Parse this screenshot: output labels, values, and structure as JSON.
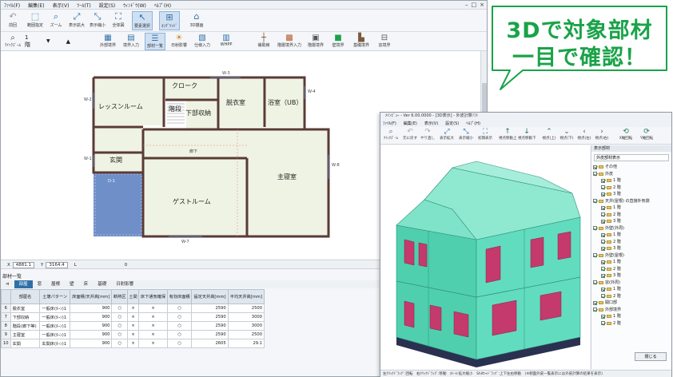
{
  "main_window": {
    "menu": [
      "ﾌｧｲﾙ(F)",
      "編集(E)",
      "表示(V)",
      "ﾂｰﾙ(T)",
      "設定(S)",
      "ｳｨﾝﾄﾞｳ(W)",
      "ﾍﾙﾌﾟ(H)"
    ],
    "toolbar1": [
      {
        "label": "前回",
        "icon": "undo-icon"
      },
      {
        "label": "範囲指定",
        "icon": "range-icon"
      },
      {
        "label": "ズーム",
        "icon": "zoom-icon"
      },
      {
        "label": "表示拡大",
        "icon": "zoom-in-icon"
      },
      {
        "label": "表示縮小",
        "icon": "zoom-out-icon"
      },
      {
        "label": "全体図",
        "icon": "fit-icon"
      },
      {
        "label": "要素選択",
        "icon": "cursor-icon"
      },
      {
        "label": "ｵﾝｸﾞﾘｯﾄﾞ",
        "icon": "grid-icon"
      },
      {
        "label": "3D描画",
        "icon": "3d-icon"
      }
    ],
    "toolbar2": {
      "left_label": "ｸｲｯｸｽﾞｰﾑ",
      "floor": "1 階",
      "buttons": [
        {
          "label": "外部境界",
          "icon": "boundary-icon"
        },
        {
          "label": "境界入力",
          "icon": "input-icon"
        },
        {
          "label": "部材一覧",
          "icon": "list-icon"
        },
        {
          "label": "日射影響",
          "icon": "sun-icon"
        },
        {
          "label": "仕様入力",
          "icon": "spec-icon"
        },
        {
          "label": "WHPP",
          "icon": "whpp-icon"
        },
        {
          "label": "補助線",
          "icon": "guide-icon"
        },
        {
          "label": "階層境界入力",
          "icon": "layer-icon"
        },
        {
          "label": "階層境界",
          "icon": "layer2-icon"
        },
        {
          "label": "壁境界",
          "icon": "wall-icon"
        },
        {
          "label": "基礎境界",
          "icon": "foundation-icon"
        },
        {
          "label": "窓境界",
          "icon": "window-icon"
        }
      ]
    },
    "rooms": [
      "レッスンルーム",
      "クローク",
      "階段",
      "下部収納",
      "脱衣室",
      "浴室（UB）",
      "玄関",
      "ゲストルーム",
      "主寝室",
      "D-1"
    ],
    "dims": [
      "W-3",
      "W-2",
      "W-4",
      "W-1",
      "W-7",
      "W-8",
      "D-1"
    ],
    "corridor_label": "廊下",
    "status": {
      "x_label": "X",
      "x_value": "4881.1",
      "y_label": "Y",
      "y_value": "3164.4",
      "l_label": "L",
      "l_value": "0"
    },
    "parts_list": {
      "title": "部材一覧",
      "tabs": [
        "部屋",
        "窓",
        "屋根",
        "壁",
        "床",
        "基礎",
        "日射影響"
      ],
      "headers": [
        "部屋名",
        "土壌パターン",
        "床面積/天井高[mm]",
        "断熱区",
        "土間",
        "床下通気確保",
        "有効床面積",
        "設定天井高[mm]",
        "平均天井高[mm]"
      ],
      "rows": [
        [
          "6",
          "脱衣室",
          "一般床(ﾀｰﾝ)1",
          "900",
          "○",
          "×",
          "×",
          "○",
          "2590",
          "2500"
        ],
        [
          "7",
          "下部収納",
          "一般床(ﾀｰﾝ)1",
          "900",
          "○",
          "×",
          "×",
          "○",
          "2590",
          "3000"
        ],
        [
          "8",
          "階段(廊下等)",
          "一般床(ﾀｰﾝ)1",
          "900",
          "○",
          "×",
          "×",
          "○",
          "2590",
          "3000"
        ],
        [
          "9",
          "主寝室",
          "一般床(ﾀｰﾝ)1",
          "900",
          "○",
          "×",
          "×",
          "○",
          "2590",
          "2500"
        ],
        [
          "10",
          "玄関",
          "玄関床(ﾀｰﾝ)1",
          "900",
          "○",
          "×",
          "×",
          "○",
          "2605",
          "29.1"
        ]
      ]
    }
  },
  "viewer": {
    "title": "ﾒｲﾝﾋﾞｭｰ - Ver 6.00.0000 - [3D表示] - 外皮計算ｿﾌﾄ",
    "menu": [
      "ﾌｧｲﾙ(F)",
      "編集(E)",
      "表示(V)",
      "設定(S)",
      "ﾍﾙﾌﾟ(H)"
    ],
    "toolbar": [
      {
        "label": "ｸｲｯｸｽﾞｰﾑ",
        "icon": "zoom-icon"
      },
      {
        "label": "元に戻す",
        "icon": "undo-icon"
      },
      {
        "label": "やり直し",
        "icon": "redo-icon"
      },
      {
        "label": "表示拡大",
        "icon": "zoom-in-icon"
      },
      {
        "label": "表示縮小",
        "icon": "zoom-out-icon"
      },
      {
        "label": "初期表示",
        "icon": "home-icon"
      },
      {
        "label": "視点移動上",
        "icon": "arrow-up-icon"
      },
      {
        "label": "視点移動下",
        "icon": "arrow-down-icon"
      },
      {
        "label": "視点(上)",
        "icon": "view-up-icon"
      },
      {
        "label": "視点(下)",
        "icon": "view-down-icon"
      },
      {
        "label": "視点(左)",
        "icon": "view-left-icon"
      },
      {
        "label": "視点(右)",
        "icon": "view-right-icon"
      },
      {
        "label": "X軸回転",
        "icon": "rotate-x-icon"
      },
      {
        "label": "Y軸回転",
        "icon": "rotate-y-icon"
      }
    ],
    "side_header": "表示部材",
    "side_dropdown": "外皮部材表示",
    "tree": [
      {
        "label": "その他",
        "level": 0,
        "checked": true
      },
      {
        "label": "外皮",
        "level": 0,
        "checked": true
      },
      {
        "label": "1 階",
        "level": 1,
        "checked": true
      },
      {
        "label": "2 階",
        "level": 1,
        "checked": true
      },
      {
        "label": "3 階",
        "level": 1,
        "checked": true
      },
      {
        "label": "天井(屋根) の直接外気側",
        "level": 0,
        "checked": true
      },
      {
        "label": "1 階",
        "level": 1,
        "checked": true
      },
      {
        "label": "2 階",
        "level": 1,
        "checked": true
      },
      {
        "label": "3 階",
        "level": 1,
        "checked": true
      },
      {
        "label": "外壁(外周)",
        "level": 0,
        "checked": true
      },
      {
        "label": "1 階",
        "level": 1,
        "checked": true
      },
      {
        "label": "2 階",
        "level": 1,
        "checked": true
      },
      {
        "label": "3 階",
        "level": 1,
        "checked": true
      },
      {
        "label": "外壁(屋根)",
        "level": 0,
        "checked": true
      },
      {
        "label": "1 階",
        "level": 1,
        "checked": true
      },
      {
        "label": "2 階",
        "level": 1,
        "checked": true
      },
      {
        "label": "3 階",
        "level": 1,
        "checked": true
      },
      {
        "label": "窓(外周)",
        "level": 0,
        "checked": true
      },
      {
        "label": "1 階",
        "level": 1,
        "checked": true
      },
      {
        "label": "2 階",
        "level": 1,
        "checked": true
      },
      {
        "label": "開口部",
        "level": 0,
        "checked": true
      },
      {
        "label": "外部境界",
        "level": 0,
        "checked": true
      },
      {
        "label": "1 階",
        "level": 1,
        "checked": true
      },
      {
        "label": "2 階",
        "level": 1,
        "checked": true
      }
    ],
    "close_label": "閉じる",
    "status": "左ｸﾘｯｸﾄﾞﾗｯｸﾞ:回転　右ｸﾘｯｸﾄﾞﾗｯｸﾞ:移動　ﾎｲｰﾙ:拡大縮小　Shift+ﾄﾞﾗｯｸﾞ:上下左右移動　(※側面外皮一覧表示には外皮計算の結果を表示)"
  },
  "callout": {
    "line1": "3Dで対象部材",
    "line2": "一目で確認！",
    "color": "#1aa349"
  },
  "colors": {
    "accent": "#2f6fa8",
    "wall": "#5a3b36",
    "floor_fill": "#eff3e3",
    "entrance_fill": "#6f8fc9",
    "model_glass": "#54d6b4",
    "model_window": "#c43a6c"
  }
}
